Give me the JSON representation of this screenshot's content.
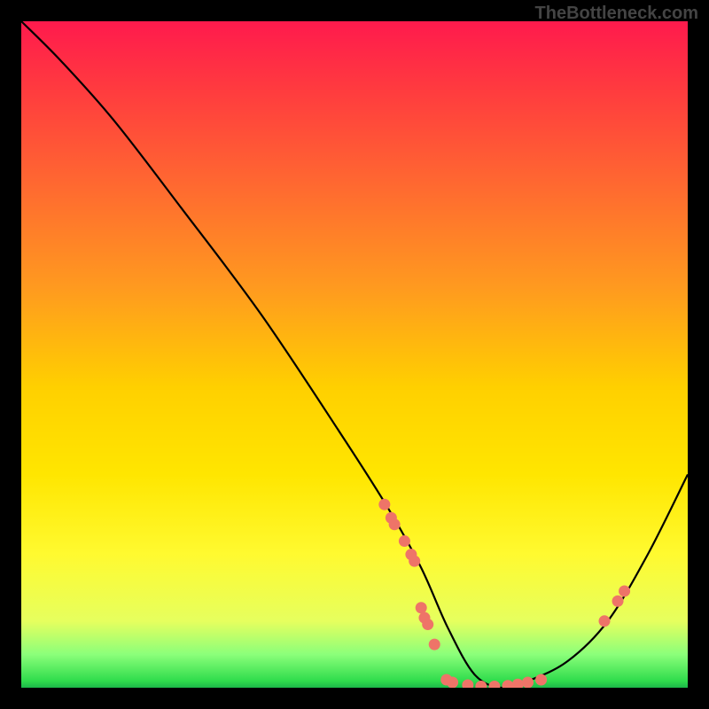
{
  "watermark": "TheBottleneck.com",
  "chart_data": {
    "type": "line",
    "title": "",
    "xlabel": "",
    "ylabel": "",
    "xlim": [
      0,
      100
    ],
    "ylim": [
      0,
      100
    ],
    "series": [
      {
        "name": "curve",
        "x": [
          0,
          6,
          14,
          24,
          36,
          48,
          55,
          60,
          64,
          68,
          72,
          76,
          82,
          88,
          94,
          100
        ],
        "values": [
          100,
          94,
          85,
          72,
          56,
          38,
          27,
          18,
          9,
          2,
          0,
          1,
          4,
          10,
          20,
          32
        ]
      }
    ],
    "markers": [
      {
        "x": 54.5,
        "y": 27.5
      },
      {
        "x": 55.5,
        "y": 25.5
      },
      {
        "x": 56.0,
        "y": 24.5
      },
      {
        "x": 57.5,
        "y": 22.0
      },
      {
        "x": 58.5,
        "y": 20.0
      },
      {
        "x": 59.0,
        "y": 19.0
      },
      {
        "x": 60.0,
        "y": 12.0
      },
      {
        "x": 60.5,
        "y": 10.5
      },
      {
        "x": 61.0,
        "y": 9.5
      },
      {
        "x": 62.0,
        "y": 6.5
      },
      {
        "x": 63.8,
        "y": 1.2
      },
      {
        "x": 64.7,
        "y": 0.8
      },
      {
        "x": 67.0,
        "y": 0.4
      },
      {
        "x": 69.0,
        "y": 0.2
      },
      {
        "x": 71.0,
        "y": 0.2
      },
      {
        "x": 73.0,
        "y": 0.3
      },
      {
        "x": 74.5,
        "y": 0.5
      },
      {
        "x": 76.0,
        "y": 0.8
      },
      {
        "x": 78.0,
        "y": 1.2
      },
      {
        "x": 87.5,
        "y": 10.0
      },
      {
        "x": 89.5,
        "y": 13.0
      },
      {
        "x": 90.5,
        "y": 14.5
      }
    ],
    "colors": {
      "curve": "#000000",
      "marker": "#ee7468"
    }
  }
}
